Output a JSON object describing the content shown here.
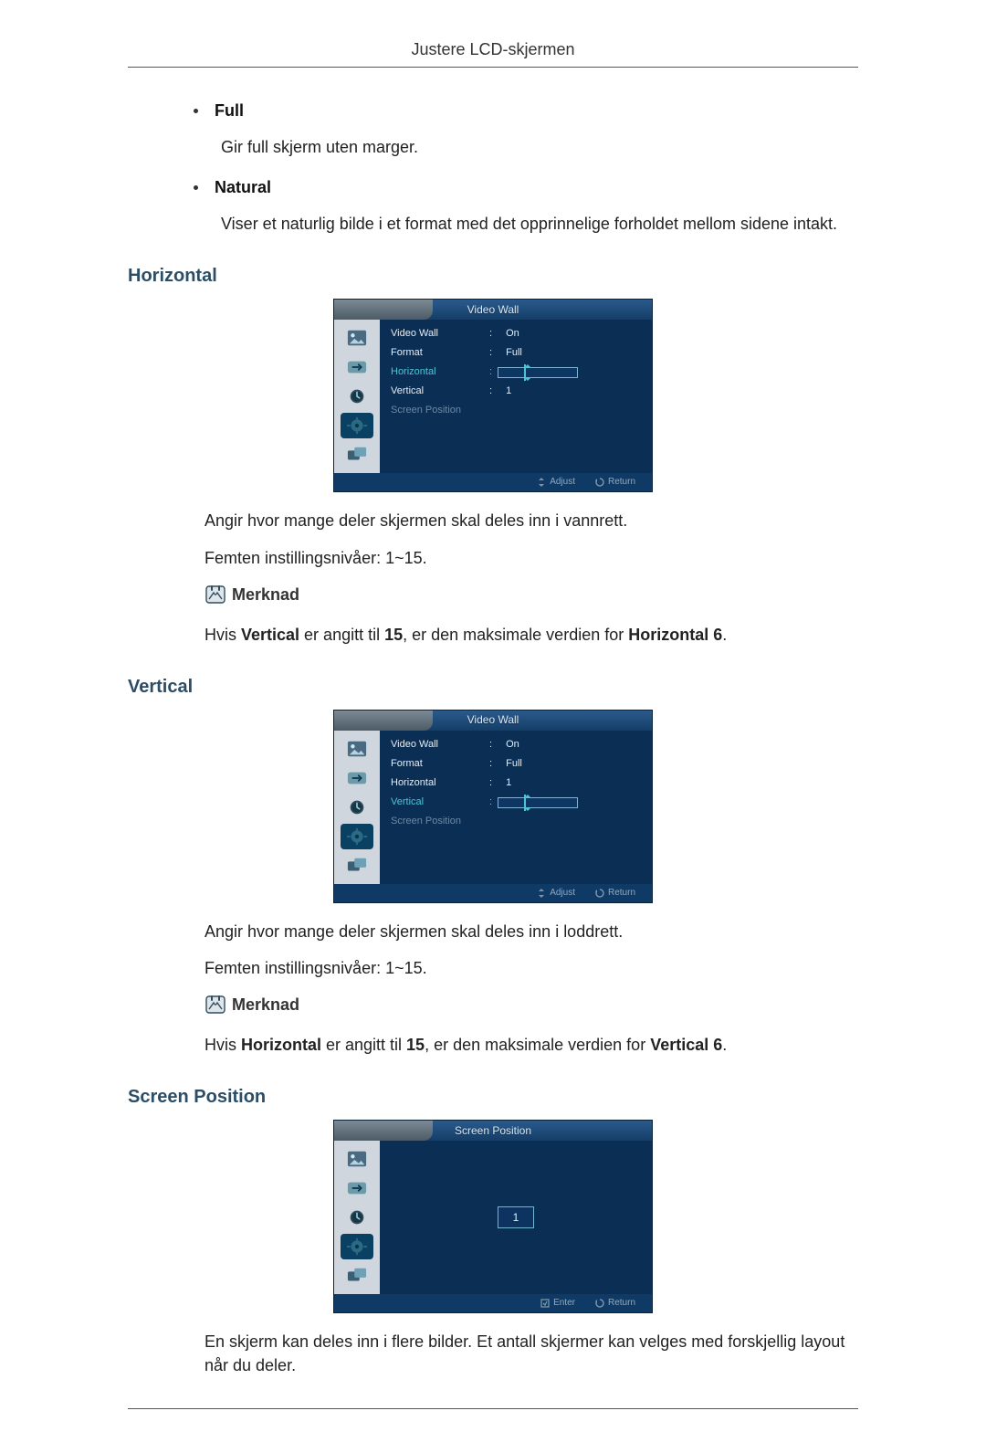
{
  "header": {
    "running": "Justere LCD-skjermen"
  },
  "options": {
    "full": {
      "label": "Full",
      "desc": "Gir full skjerm uten marger."
    },
    "natural": {
      "label": "Natural",
      "desc": "Viser et naturlig bilde i et format med det opprinnelige forholdet mellom sidene intakt."
    }
  },
  "osd_common": {
    "title": "Video Wall",
    "rows": {
      "videowall": {
        "label": "Video Wall",
        "colon": ":",
        "value": "On"
      },
      "format": {
        "label": "Format",
        "colon": ":",
        "value": "Full"
      },
      "horizontal": {
        "label": "Horizontal",
        "colon": ":"
      },
      "vertical": {
        "label": "Vertical",
        "colon": ":",
        "value": "1"
      },
      "screenpos": {
        "label": "Screen Position"
      }
    },
    "footer": {
      "adjust": "Adjust",
      "return": "Return",
      "enter": "Enter"
    }
  },
  "sections": {
    "horizontal": {
      "title": "Horizontal",
      "p1": "Angir hvor mange deler skjermen skal deles inn i vannrett.",
      "p2": "Femten instillingsnivåer: 1~15.",
      "note": "Merknad",
      "note_body_pre": "Hvis ",
      "note_body_b1": "Vertical",
      "note_body_mid": " er angitt til ",
      "note_body_b2": "15",
      "note_body_mid2": ", er den maksimale verdien for ",
      "note_body_b3": "Horizontal 6",
      "note_body_end": "."
    },
    "vertical": {
      "title": "Vertical",
      "p1": "Angir hvor mange deler skjermen skal deles inn i loddrett.",
      "p2": "Femten instillingsnivåer: 1~15.",
      "note": "Merknad",
      "note_body_pre": "Hvis ",
      "note_body_b1": "Horizontal",
      "note_body_mid": " er angitt til ",
      "note_body_b2": "15",
      "note_body_mid2": ", er den maksimale verdien for ",
      "note_body_b3": "Vertical 6",
      "note_body_end": "."
    },
    "screenpos": {
      "title": "Screen Position",
      "osd_title": "Screen Position",
      "value": "1",
      "p1": "En skjerm kan deles inn i flere bilder. Et antall skjermer kan velges med forskjellig layout når du deler."
    }
  }
}
